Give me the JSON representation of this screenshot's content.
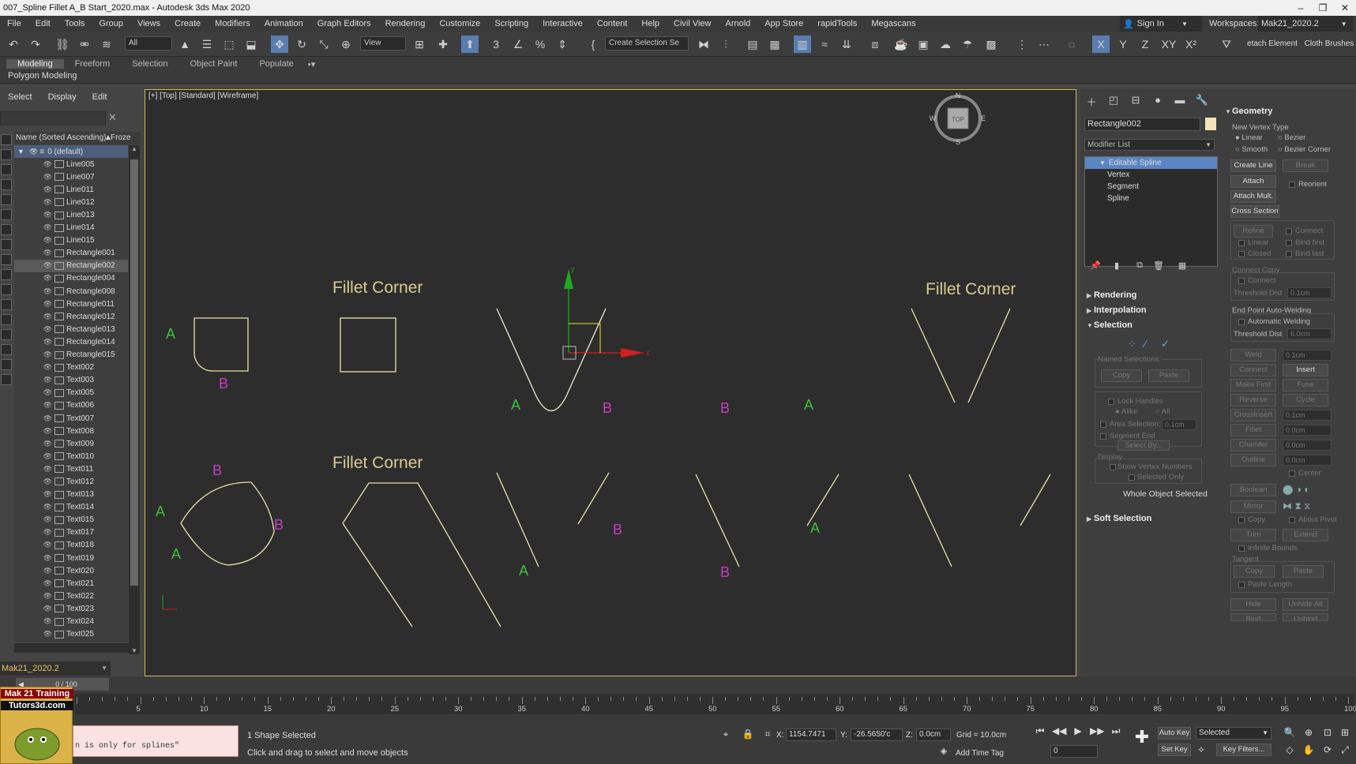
{
  "titlebar": {
    "text": "007_Spline Fillet A_B Start_2020.max - Autodesk 3ds Max 2020"
  },
  "menu": [
    "File",
    "Edit",
    "Tools",
    "Group",
    "Views",
    "Create",
    "Modifiers",
    "Animation",
    "Graph Editors",
    "Rendering",
    "Customize",
    "Scripting",
    "Interactive",
    "Content",
    "Help",
    "Civil View",
    "Arnold",
    "App Store",
    "rapidTools",
    "Megascans"
  ],
  "signin": "Sign In",
  "workspaces_label": "Workspaces:",
  "workspace": "Mak21_2020.2",
  "toolbar": {
    "selection_filter": "All",
    "view_dropdown": "View",
    "selection_set": "Create Selection Se",
    "axis_x": "X",
    "axis_y": "Y",
    "axis_z": "Z",
    "axis_xy": "XY",
    "axis_x2": "X²",
    "detach_label": "etach Element",
    "brushes_label": "Cloth Brushes"
  },
  "ribbon": {
    "tabs": [
      "Modeling",
      "Freeform",
      "Selection",
      "Object Paint",
      "Populate"
    ],
    "active": "Modeling",
    "sub": "Polygon Modeling"
  },
  "scene": {
    "menu": [
      "Select",
      "Display",
      "Edit"
    ],
    "column": "Name (Sorted Ascending)",
    "frozen": "Froze",
    "layer": "0 (default)",
    "items": [
      "Line005",
      "Line007",
      "Line011",
      "Line012",
      "Line013",
      "Line014",
      "Line015",
      "Rectangle001",
      "Rectangle002",
      "Rectangle004",
      "Rectangle008",
      "Rectangle011",
      "Rectangle012",
      "Rectangle013",
      "Rectangle014",
      "Rectangle015",
      "Text002",
      "Text003",
      "Text005",
      "Text006",
      "Text007",
      "Text008",
      "Text009",
      "Text010",
      "Text011",
      "Text012",
      "Text013",
      "Text014",
      "Text015",
      "Text017",
      "Text018",
      "Text019",
      "Text020",
      "Text021",
      "Text022",
      "Text023",
      "Text024",
      "Text025"
    ],
    "selected": "Rectangle002",
    "layer_field": "Mak21_2020.2"
  },
  "viewport": {
    "label": "[+] [Top] [Standard] [Wireframe]",
    "texts": {
      "fillet1": "Fillet Corner",
      "fillet2": "Fillet Corner",
      "fillet3": "Fillet Corner",
      "A": "A",
      "B": "B"
    },
    "gizmo_x": "x",
    "gizmo_y": "y",
    "compass": {
      "n": "N",
      "s": "S",
      "w": "W",
      "e": "E",
      "top": "TOP"
    }
  },
  "cmd": {
    "object_name": "Rectangle002",
    "modifier_list": "Modifier List",
    "stack": [
      "Editable Spline",
      "Vertex",
      "Segment",
      "Spline"
    ],
    "rollouts": {
      "rendering": "Rendering",
      "interpolation": "Interpolation",
      "selection": "Selection",
      "soft": "Soft Selection",
      "geometry": "Geometry"
    },
    "named_sel": "Named Selections:",
    "copy": "Copy",
    "paste": "Paste",
    "lock_handles": "Lock Handles",
    "alike": "Alike",
    "all": "All",
    "area_sel": "Area Selection:",
    "area_val": "0.1cm",
    "seg_end": "Segment End",
    "select_by": "Select By...",
    "display": "Display",
    "show_vnum": "Show Vertex Numbers",
    "sel_only": "Selected Only",
    "whole_obj": "Whole Object Selected",
    "geo": {
      "new_vertex": "New Vertex Type",
      "linear": "Linear",
      "bezier": "Bezier",
      "smooth": "Smooth",
      "bezier_corner": "Bezier Corner",
      "create_line": "Create Line",
      "break": "Break",
      "attach": "Attach",
      "reorient": "Reorient",
      "attach_mult": "Attach Mult.",
      "cross_section": "Cross Section",
      "refine": "Refine",
      "connect": "Connect",
      "linear2": "Linear",
      "bind_first": "Bind first",
      "closed": "Closed",
      "bind_last": "Bind last",
      "connect_copy": "Connect Copy",
      "connect2": "Connect",
      "threshold": "Threshold Dist",
      "thr_val": "0.1cm",
      "endpoint": "End Point Auto-Welding",
      "auto_weld": "Automatic Welding",
      "thr2": "Threshold Dist",
      "thr2_val": "6.0cm",
      "weld": "Weld",
      "weld_val": "0.1cm",
      "connect3": "Connect",
      "insert": "Insert",
      "make_first": "Make First",
      "fuse": "Fuse",
      "reverse": "Reverse",
      "cycle": "Cycle",
      "crossinsert": "CrossInsert",
      "ci_val": "0.1cm",
      "fillet": "Fillet",
      "fillet_val": "0.0cm",
      "chamfer": "Chamfer",
      "chamfer_val": "0.0cm",
      "outline": "Outline",
      "outline_val": "0.0cm",
      "center": "Center",
      "boolean": "Boolean",
      "mirror": "Mirror",
      "copy": "Copy",
      "about_pivot": "About Pivot",
      "trim": "Trim",
      "extend": "Extend",
      "infinite": "Infinite Bounds",
      "tangent": "Tangent",
      "tcopy": "Copy",
      "tpaste": "Paste",
      "paste_len": "Paste Length",
      "hide": "Hide",
      "unhide_all": "Unhide All",
      "bind": "Bind",
      "unbind": "Unbind"
    }
  },
  "timeline": {
    "ticks": [
      "5",
      "10",
      "15",
      "20",
      "25",
      "30",
      "35",
      "40",
      "45",
      "50",
      "55",
      "60",
      "65",
      "70",
      "75",
      "80",
      "85",
      "90",
      "95",
      "100"
    ],
    "frame": "0 / 100"
  },
  "status": {
    "logo1": "Mak 21 Training",
    "logo2": "Tutors3d.com",
    "script": "n is only for splines\"",
    "shapes": "1 Shape Selected",
    "hint": "Click and drag to select and move objects",
    "x_label": "X:",
    "x": "1154.7471",
    "y_label": "Y:",
    "y": "-26.5650'c",
    "z_label": "Z:",
    "z": "0.0cm",
    "grid": "Grid = 10.0cm",
    "add_time_tag": "Add Time Tag",
    "auto_key": "Auto Key",
    "selected": "Selected",
    "set_key": "Set Key",
    "key_filters": "Key Filters...",
    "frame_field": "0"
  },
  "colors": {
    "viewport_bg": "#2d2d2d",
    "shape_yellow": "#e9e3a8",
    "text_tan": "#d8cc93",
    "label_green": "#3fbf3f",
    "label_magenta": "#c43fbf",
    "gizmo_green": "#1fa81f",
    "gizmo_red": "#d11f1f",
    "accent_blue": "#5a86c4"
  }
}
